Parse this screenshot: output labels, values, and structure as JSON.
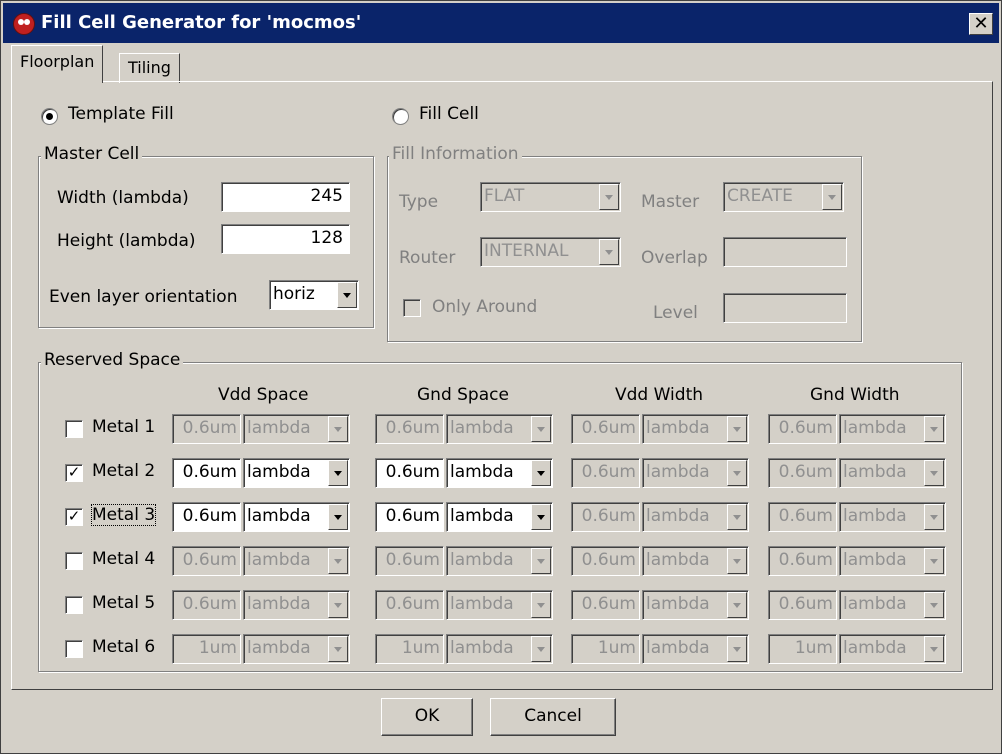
{
  "window": {
    "title": "Fill Cell Generator for 'mocmos'",
    "close_label": "✕"
  },
  "tabs": [
    {
      "label": "Floorplan",
      "selected": true
    },
    {
      "label": "Tiling",
      "selected": false
    }
  ],
  "mode": {
    "template_fill_label": "Template Fill",
    "fill_cell_label": "Fill Cell",
    "selected": "template_fill"
  },
  "master_cell": {
    "title": "Master Cell",
    "width_label": "Width (lambda)",
    "width_value": "245",
    "height_label": "Height (lambda)",
    "height_value": "128",
    "orientation_label": "Even layer orientation",
    "orientation_value": "horiz"
  },
  "fill_info": {
    "title": "Fill Information",
    "type_label": "Type",
    "type_value": "FLAT",
    "master_label": "Master",
    "master_value": "CREATE",
    "router_label": "Router",
    "router_value": "INTERNAL",
    "overlap_label": "Overlap",
    "overlap_value": "",
    "only_around_label": "Only Around",
    "level_label": "Level",
    "level_value": ""
  },
  "reserved": {
    "title": "Reserved Space",
    "headers": [
      "Vdd Space",
      "Gnd Space",
      "Vdd Width",
      "Gnd Width"
    ],
    "rows": [
      {
        "label": "Metal 1",
        "checked": false,
        "vdd_space": "0.6um",
        "vdd_space_unit": "lambda",
        "gnd_space": "0.6um",
        "gnd_space_unit": "lambda",
        "vdd_width": "0.6um",
        "vdd_width_unit": "lambda",
        "gnd_width": "0.6um",
        "gnd_width_unit": "lambda"
      },
      {
        "label": "Metal 2",
        "checked": true,
        "vdd_space": "0.6um",
        "vdd_space_unit": "lambda",
        "gnd_space": "0.6um",
        "gnd_space_unit": "lambda",
        "vdd_width": "0.6um",
        "vdd_width_unit": "lambda",
        "gnd_width": "0.6um",
        "gnd_width_unit": "lambda"
      },
      {
        "label": "Metal 3",
        "checked": true,
        "vdd_space": "0.6um",
        "vdd_space_unit": "lambda",
        "gnd_space": "0.6um",
        "gnd_space_unit": "lambda",
        "vdd_width": "0.6um",
        "vdd_width_unit": "lambda",
        "gnd_width": "0.6um",
        "gnd_width_unit": "lambda"
      },
      {
        "label": "Metal 4",
        "checked": false,
        "vdd_space": "0.6um",
        "vdd_space_unit": "lambda",
        "gnd_space": "0.6um",
        "gnd_space_unit": "lambda",
        "vdd_width": "0.6um",
        "vdd_width_unit": "lambda",
        "gnd_width": "0.6um",
        "gnd_width_unit": "lambda"
      },
      {
        "label": "Metal 5",
        "checked": false,
        "vdd_space": "0.6um",
        "vdd_space_unit": "lambda",
        "gnd_space": "0.6um",
        "gnd_space_unit": "lambda",
        "vdd_width": "0.6um",
        "vdd_width_unit": "lambda",
        "gnd_width": "0.6um",
        "gnd_width_unit": "lambda"
      },
      {
        "label": "Metal 6",
        "checked": false,
        "vdd_space": "1um",
        "vdd_space_unit": "lambda",
        "gnd_space": "1um",
        "gnd_space_unit": "lambda",
        "vdd_width": "1um",
        "vdd_width_unit": "lambda",
        "gnd_width": "1um",
        "gnd_width_unit": "lambda"
      }
    ]
  },
  "buttons": {
    "ok_label": "OK",
    "cancel_label": "Cancel"
  }
}
